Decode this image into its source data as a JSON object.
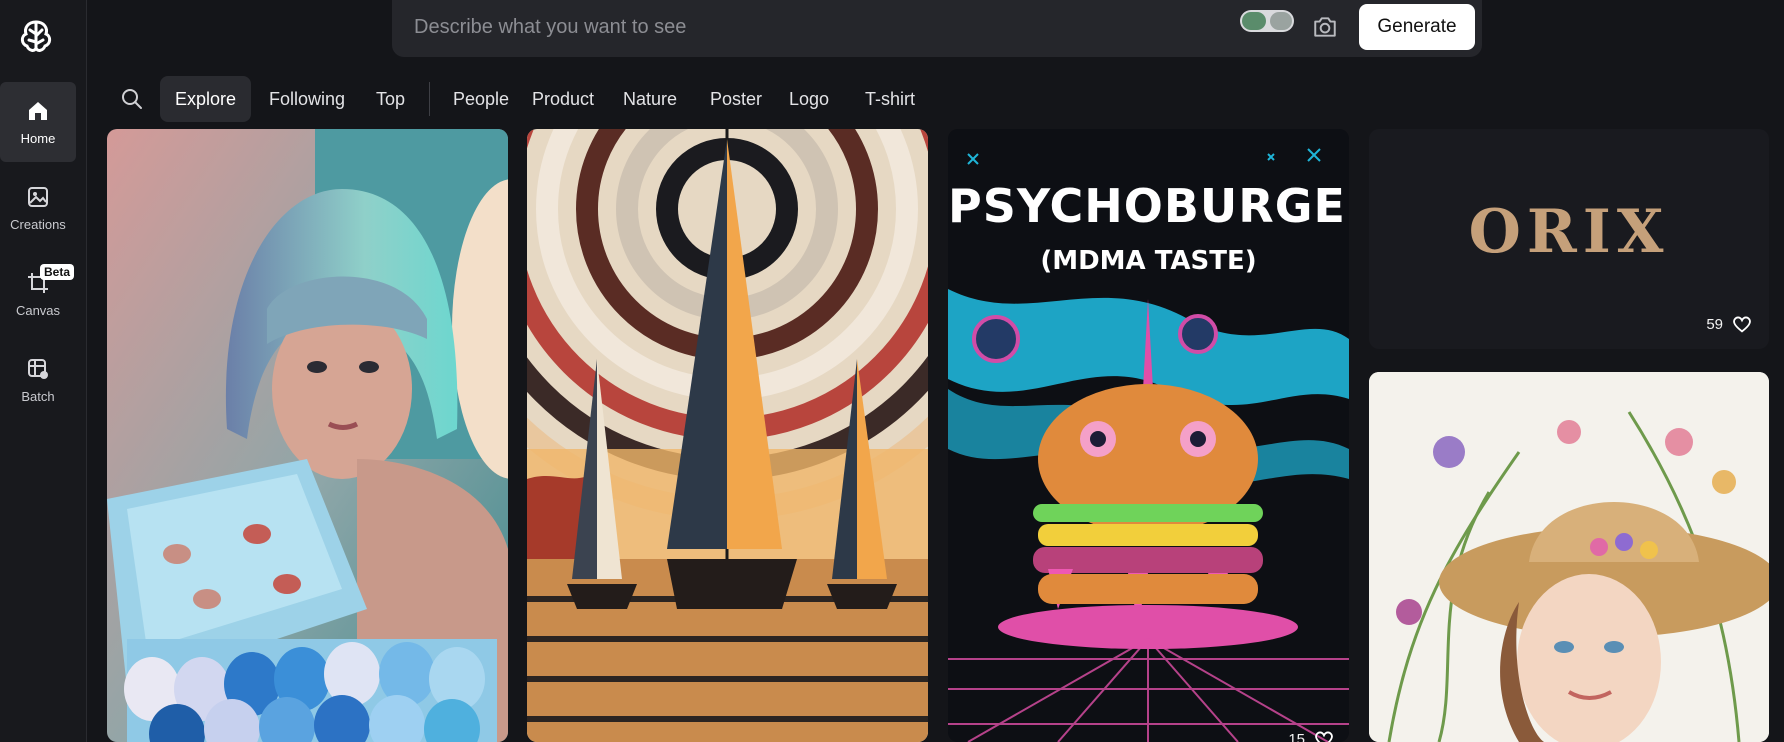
{
  "sidebar": {
    "items": [
      {
        "label": "Home",
        "icon": "home-icon",
        "active": true
      },
      {
        "label": "Creations",
        "icon": "image-icon",
        "active": false
      },
      {
        "label": "Canvas",
        "icon": "crop-icon",
        "active": false,
        "badge": "Beta"
      },
      {
        "label": "Batch",
        "icon": "batch-grid-icon",
        "active": false
      }
    ]
  },
  "prompt": {
    "placeholder": "Describe what you want to see",
    "generate_label": "Generate"
  },
  "tabs": [
    "Explore",
    "Following",
    "Top",
    "People",
    "Product",
    "Nature",
    "Poster",
    "Logo",
    "T-shirt"
  ],
  "active_tab": "Explore",
  "gallery": [
    {
      "subject": "woman with pastel bob holding blue egg carton"
    },
    {
      "subject": "sailboats on a swirling sunset sea"
    },
    {
      "subject": "psychedelic burger poster",
      "poster_title": "PSYCHOBURGER",
      "poster_subtitle": "(MDMA TASTE)",
      "likes": "15"
    },
    {
      "subject": "ORIX logo",
      "logo_text": "ORIX",
      "likes": "59"
    },
    {
      "subject": "watercolor woman in straw hat with flowers"
    }
  ],
  "colors": {
    "accent": "#ffffff",
    "background": "#141519",
    "sidebar": "#18191d"
  }
}
